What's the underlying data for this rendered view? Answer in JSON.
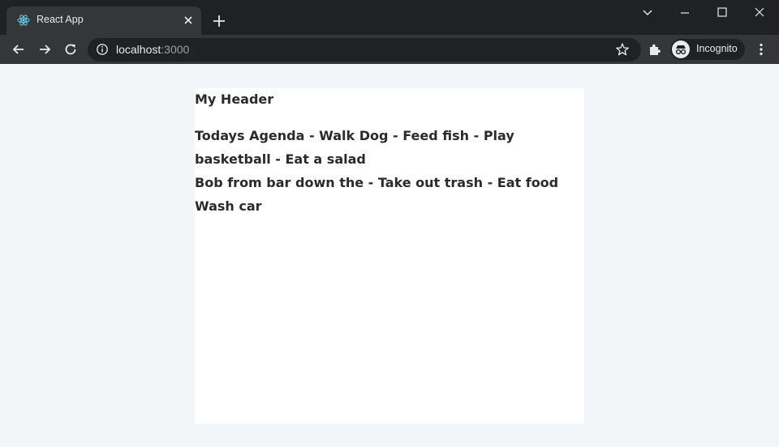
{
  "browser": {
    "tab_title": "React App",
    "url_host": "localhost",
    "url_port": ":3000",
    "incognito_label": "Incognito"
  },
  "app": {
    "header": "My Header",
    "lines": [
      "Todays Agenda - Walk Dog - Feed fish - Play basketball - Eat a salad",
      "Bob from bar down the - Take out trash - Eat food",
      "Wash car"
    ]
  },
  "colors": {
    "browser_frame": "#202124",
    "toolbar": "#35363a",
    "page_background": "#f3f6f8",
    "app_background": "#ffffff",
    "text": "#2b2b2b"
  }
}
